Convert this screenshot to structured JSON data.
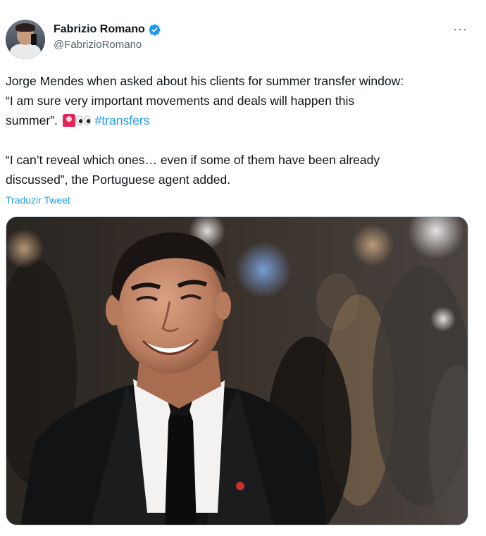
{
  "author": {
    "display_name": "Fabrizio Romano",
    "handle": "@FabrizioRomano",
    "verified": true,
    "verified_color": "#1d9bf0"
  },
  "tweet": {
    "line1": "Jorge Mendes when asked about his clients for summer transfer window:",
    "line2": "“I am sure very important movements and deals will happen this",
    "line3_prefix": "summer”.",
    "emojis": [
      "police-car-light",
      "eyes"
    ],
    "hashtag": "#transfers",
    "para2_line1": "“I can’t reveal which ones… even if some of them have been already",
    "para2_line2": "discussed”, the Portuguese agent added."
  },
  "translate_label": "Traduzir Tweet",
  "more_label": "···",
  "colors": {
    "link": "#1d9bf0",
    "secondary_text": "#536471",
    "primary_text": "#0f1419"
  }
}
